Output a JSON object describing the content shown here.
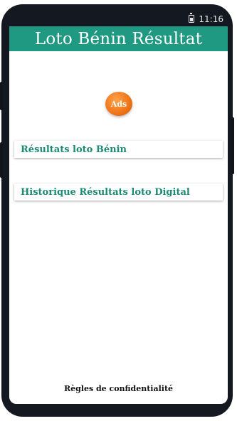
{
  "status_bar": {
    "time": "11:16",
    "battery_icon": "battery-icon"
  },
  "app_bar": {
    "title": "Loto Bénin Résultat",
    "color": "#1f9982"
  },
  "ads": {
    "label": "Ads",
    "color": "#f0771b"
  },
  "menu": {
    "items": [
      {
        "label": "Résultats loto Bénin"
      },
      {
        "label": "Historique Résultats loto Digital"
      }
    ],
    "text_color": "#1c8a74"
  },
  "footer": {
    "privacy_label": "Règles de confidentialité"
  }
}
